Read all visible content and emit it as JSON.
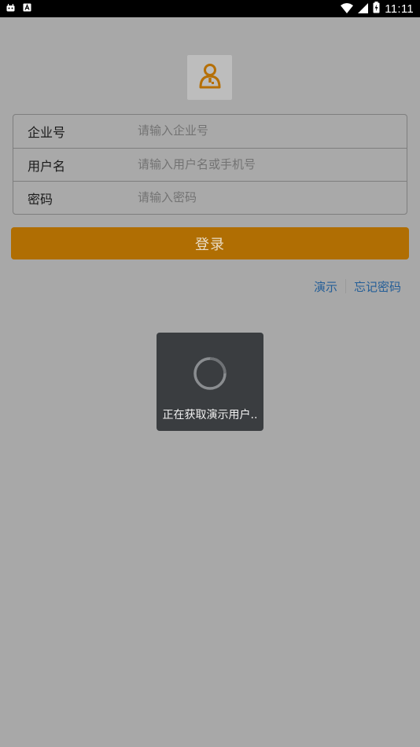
{
  "status_bar": {
    "time": "11:11",
    "left_icons": [
      "android-debug-icon",
      "a-notification-icon"
    ],
    "right_icons": [
      "wifi-icon",
      "signal-icon",
      "battery-charging-icon"
    ]
  },
  "logo": {
    "icon": "user-avatar-icon"
  },
  "form": {
    "company": {
      "label": "企业号",
      "placeholder": "请输入企业号",
      "value": ""
    },
    "username": {
      "label": "用户名",
      "placeholder": "请输入用户名或手机号",
      "value": ""
    },
    "password": {
      "label": "密码",
      "placeholder": "请输入密码",
      "value": ""
    }
  },
  "login_button": {
    "label": "登录"
  },
  "links": {
    "demo": "演示",
    "forgot_password": "忘记密码"
  },
  "loading_dialog": {
    "message": "正在获取演示用户.."
  },
  "colors": {
    "accent": "#b06e03",
    "link": "#245e97",
    "overlay_bg": "#a8a8a8",
    "dialog_bg": "#3a3d40"
  }
}
